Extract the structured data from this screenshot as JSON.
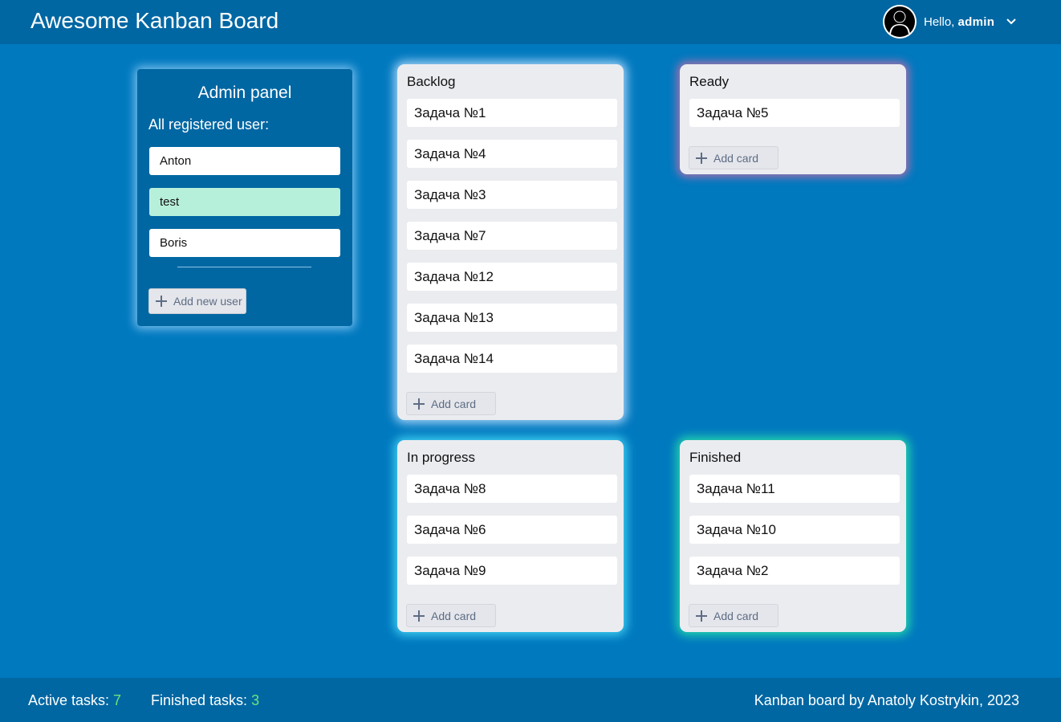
{
  "app": {
    "title": "Awesome Kanban Board"
  },
  "user_menu": {
    "greeting": "Hello,",
    "username": "admin",
    "avatar_icon": "user-silhouette-icon",
    "chevron_icon": "chevron-down-icon"
  },
  "admin_panel": {
    "title": "Admin panel",
    "subtitle": "All registered user:",
    "users": [
      {
        "name": "Anton",
        "selected": false
      },
      {
        "name": "test",
        "selected": true
      },
      {
        "name": "Boris",
        "selected": false
      }
    ],
    "add_user_label": "Add new user"
  },
  "columns": {
    "backlog": {
      "title": "Backlog",
      "cards": [
        "Задача №1",
        "Задача №4",
        "Задача №3",
        "Задача №7",
        "Задача №12",
        "Задача №13",
        "Задача №14"
      ],
      "add_label": "Add card"
    },
    "ready": {
      "title": "Ready",
      "cards": [
        "Задача №5"
      ],
      "add_label": "Add card"
    },
    "in_progress": {
      "title": "In progress",
      "cards": [
        "Задача №8",
        "Задача №6",
        "Задача №9"
      ],
      "add_label": "Add card"
    },
    "finished": {
      "title": "Finished",
      "cards": [
        "Задача №11",
        "Задача №10",
        "Задача №2"
      ],
      "add_label": "Add card"
    }
  },
  "footer": {
    "active_label": "Active tasks:",
    "active_count": "7",
    "finished_label": "Finished tasks:",
    "finished_count": "3",
    "credit": "Kanban board by Anatoly Kostrykin, 2023"
  },
  "colors": {
    "background": "#0079bf",
    "header": "#0067a3",
    "selected_user": "#b7f0da",
    "count_accent": "#6ee37a"
  }
}
